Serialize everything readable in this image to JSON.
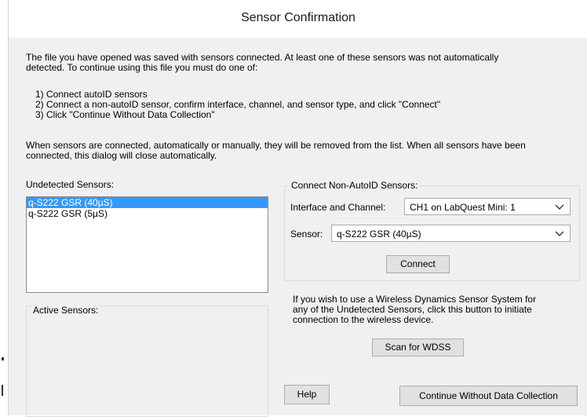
{
  "dialog": {
    "title": "Sensor Confirmation",
    "intro_line1": "The file you have opened was saved with sensors connected. At least one of these sensors was not automatically",
    "intro_line2": "detected. To continue using this file you must do one of:",
    "option1": "1) Connect autoID sensors",
    "option2": "2) Connect a non-autoID sensor, confirm interface, channel, and sensor type, and click \"Connect\"",
    "option3": "3) Click \"Continue Without Data Collection\"",
    "note_line1": "When sensors are connected, automatically or manually, they will be removed from the list. When all sensors have been",
    "note_line2": "connected, this dialog will close automatically."
  },
  "undetected": {
    "label": "Undetected Sensors:",
    "items": [
      "q-S222 GSR (40µS)",
      "q-S222 GSR (5µS)"
    ]
  },
  "active": {
    "label": "Active Sensors:"
  },
  "connect_panel": {
    "label": "Connect Non-AutoID Sensors:",
    "interface_label": "Interface and Channel:",
    "interface_value": "CH1 on LabQuest Mini: 1",
    "sensor_label": "Sensor:",
    "sensor_value": "q-S222 GSR (40µS)",
    "connect_button": "Connect"
  },
  "wireless": {
    "line1": "If you wish to use a Wireless Dynamics Sensor System for",
    "line2": "any of the Undetected Sensors, click this button to initiate",
    "line3": "connection to the wireless device.",
    "scan_button": "Scan for WDSS"
  },
  "footer": {
    "help_button": "Help",
    "continue_button": "Continue Without Data Collection"
  },
  "icons": {
    "dropdown": "chevron-down-icon"
  },
  "colors": {
    "selection": "#3399ff",
    "dialog_bg": "#f0f0f0",
    "button_bg": "#e1e1e1"
  }
}
